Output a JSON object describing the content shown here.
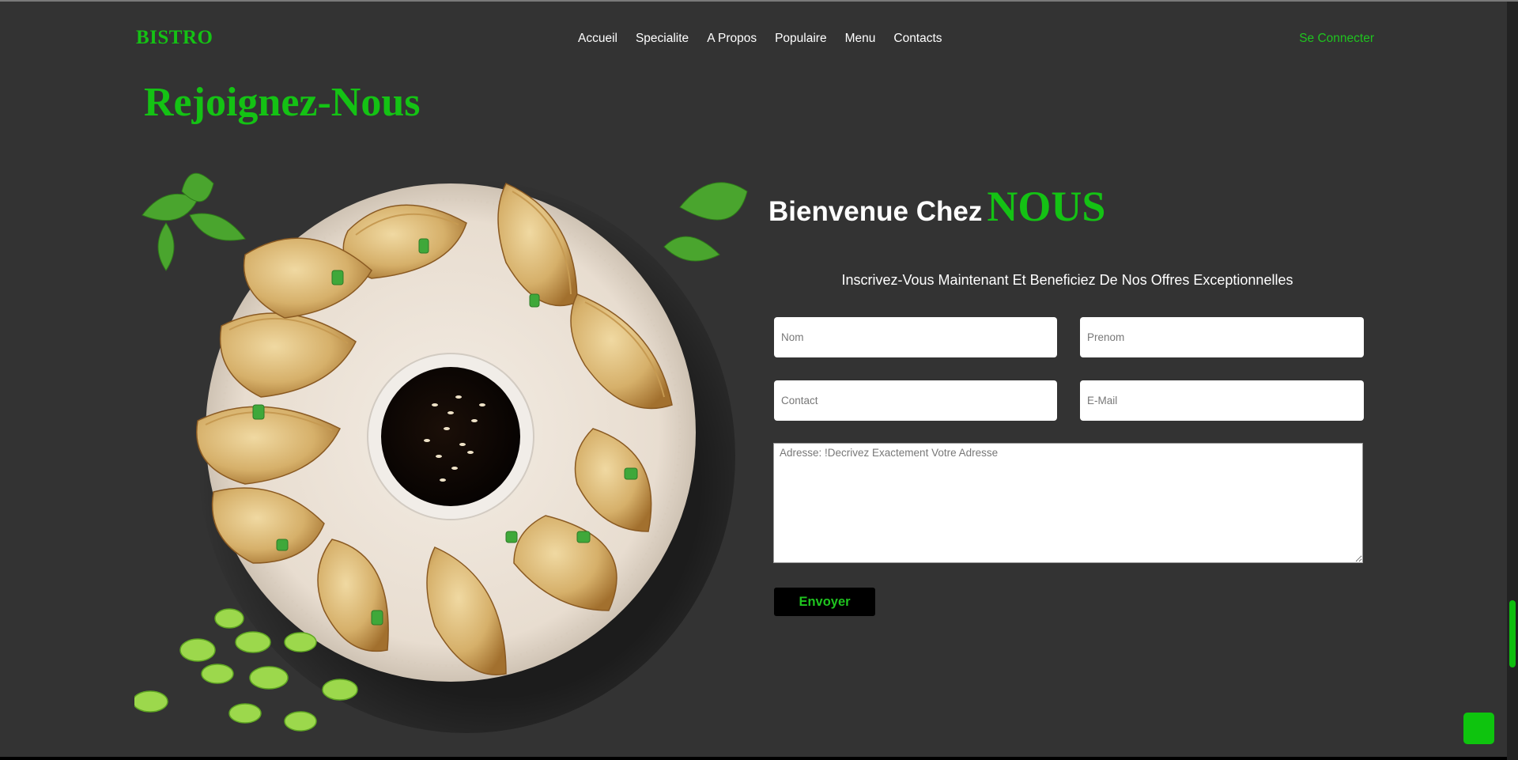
{
  "navbar": {
    "logo": "BISTRO",
    "links": [
      "Accueil",
      "Specialite",
      "A Propos",
      "Populaire",
      "Menu",
      "Contacts"
    ],
    "login": "Se Connecter"
  },
  "section": {
    "title": "Rejoignez-Nous"
  },
  "form": {
    "welcome": "Bienvenue Chez",
    "welcome_accent": "NOUS",
    "subtitle": "Inscrivez-Vous Maintenant Et Beneficiez De Nos Offres Exceptionnelles",
    "nom_placeholder": "Nom",
    "prenom_placeholder": "Prenom",
    "contact_placeholder": "Contact",
    "email_placeholder": "E-Mail",
    "adresse_placeholder": "Adresse: !Decrivez Exactement Votre Adresse",
    "submit": "Envoyer"
  },
  "colors": {
    "accent": "#14c214",
    "background": "#333333"
  }
}
